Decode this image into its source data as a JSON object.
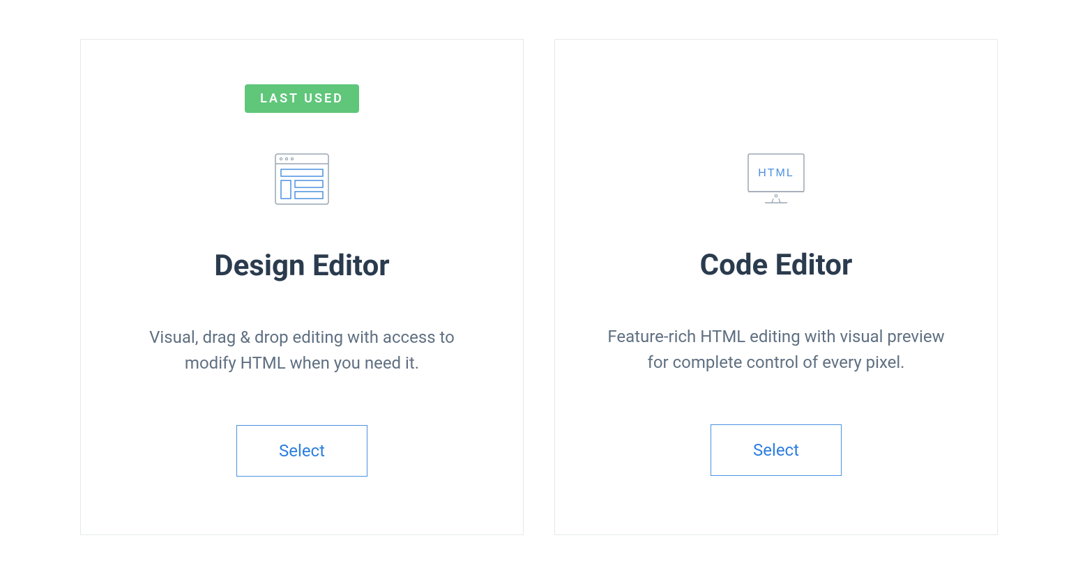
{
  "cards": [
    {
      "badge": "LAST USED",
      "title": "Design Editor",
      "description": "Visual, drag & drop editing with access to modify HTML when you need it.",
      "button_label": "Select"
    },
    {
      "badge": null,
      "title": "Code Editor",
      "description": "Feature-rich HTML editing with visual preview for complete control of every pixel.",
      "button_label": "Select"
    }
  ]
}
